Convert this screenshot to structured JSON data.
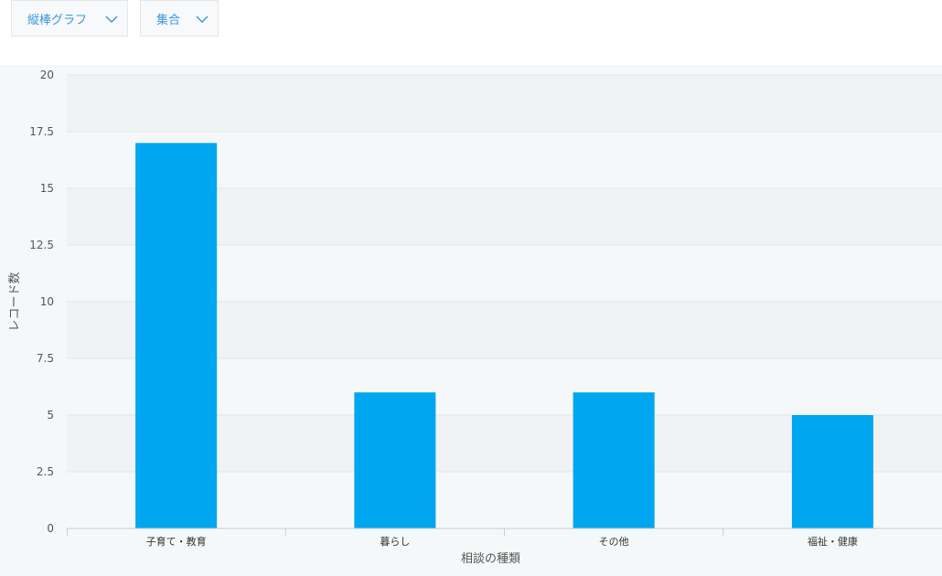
{
  "toolbar": {
    "chart_type_label": "縦棒グラフ",
    "aggregation_label": "集合"
  },
  "colors": {
    "bar": "#00a6ef",
    "accent": "#3498db",
    "band": "#f0f2f3",
    "background": "#f5f8f9"
  },
  "chart_data": {
    "type": "bar",
    "categories": [
      "子育て・教育",
      "暮らし",
      "その他",
      "福祉・健康"
    ],
    "values": [
      17,
      6,
      6,
      5
    ],
    "xlabel": "相談の種類",
    "ylabel": "レコード数",
    "ylim": [
      0,
      20
    ],
    "yticks": [
      0,
      2.5,
      5,
      7.5,
      10,
      12.5,
      15,
      17.5,
      20
    ],
    "ytick_labels": [
      "0",
      "2.5",
      "5",
      "7.5",
      "10",
      "12.5",
      "15",
      "17.5",
      "20"
    ],
    "grid": true,
    "legend": "none"
  }
}
